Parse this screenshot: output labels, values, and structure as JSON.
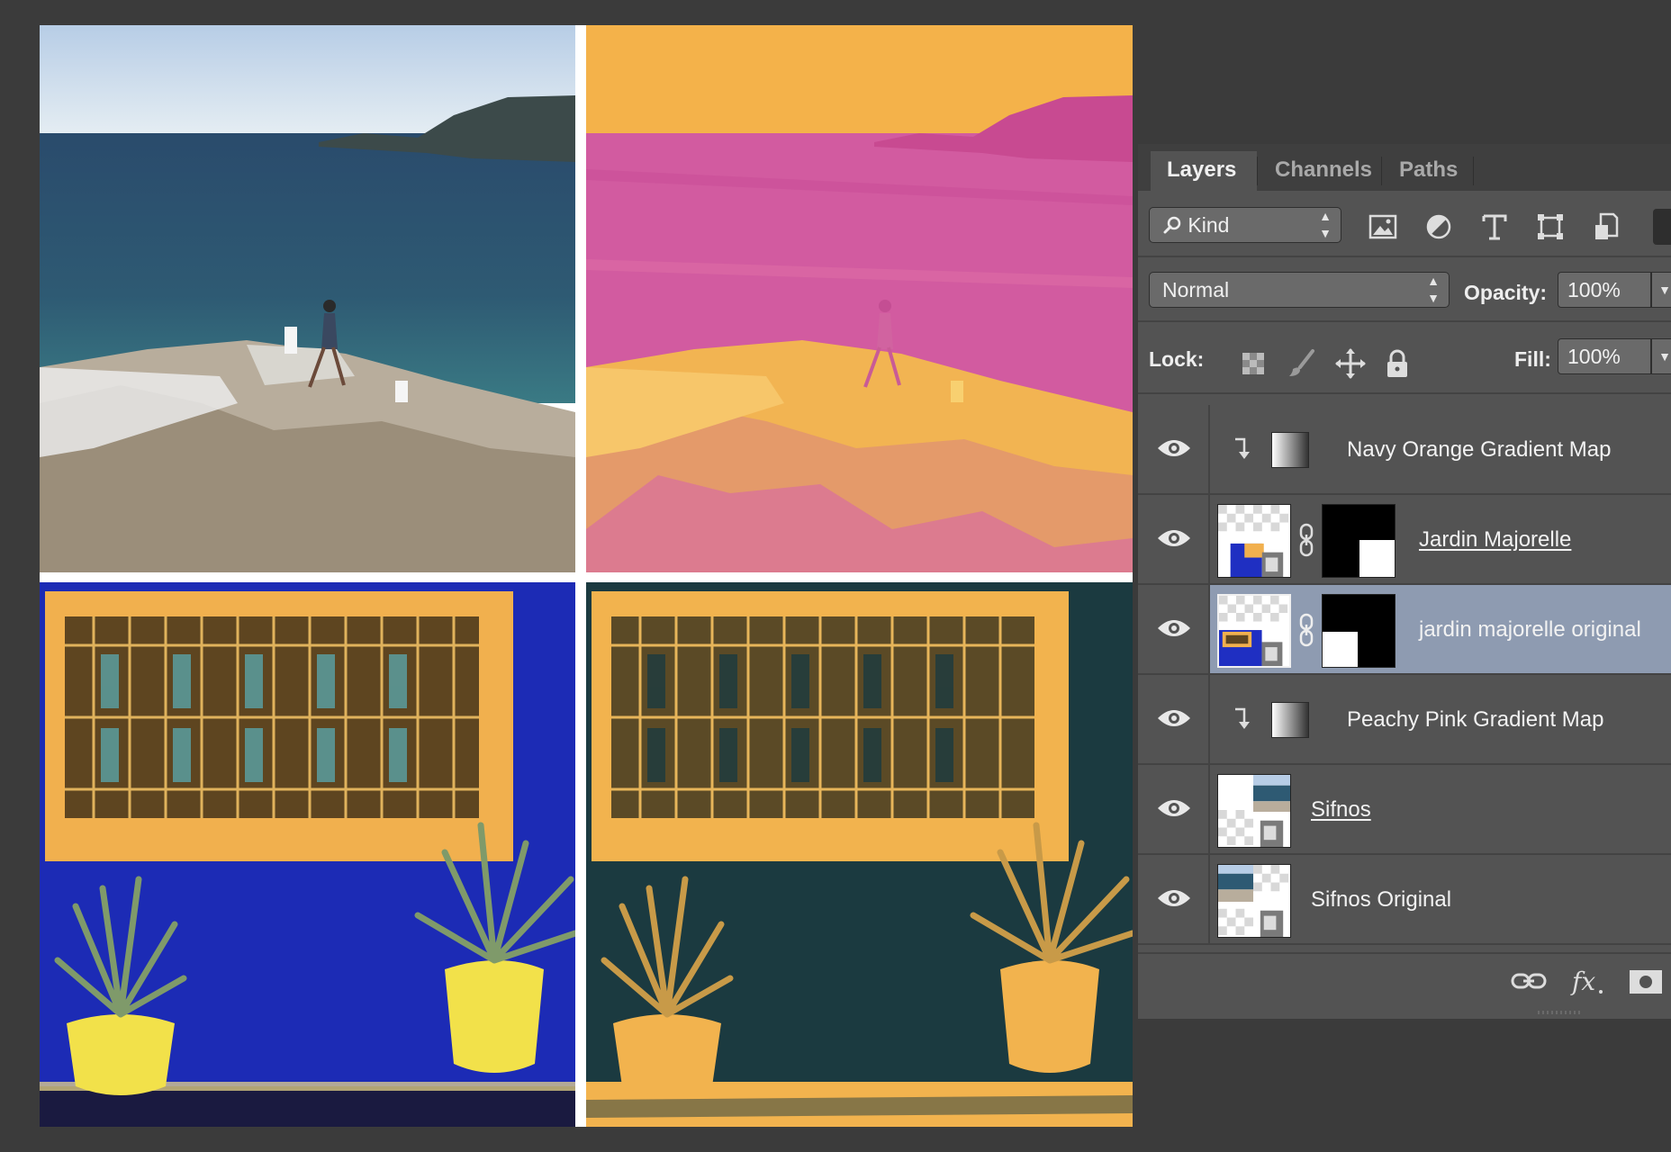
{
  "panel": {
    "tabs": [
      {
        "label": "Layers",
        "active": true
      },
      {
        "label": "Channels",
        "active": false
      },
      {
        "label": "Paths",
        "active": false
      }
    ],
    "filter": {
      "kind_label": "Kind",
      "icons": [
        "image-filter-icon",
        "adjustment-filter-icon",
        "type-filter-icon",
        "shape-filter-icon",
        "smart-object-filter-icon"
      ]
    },
    "blend_mode": "Normal",
    "opacity_label": "Opacity:",
    "opacity_value": "100%",
    "lock_label": "Lock:",
    "fill_label": "Fill:",
    "fill_value": "100%",
    "layers": [
      {
        "name": "Navy Orange Gradient Map",
        "type": "adjustment",
        "clipped": true,
        "visible": true,
        "selected": false
      },
      {
        "name": "Jardin Majorelle",
        "type": "smart",
        "masked": true,
        "visible": true,
        "selected": false
      },
      {
        "name": "jardin majorelle original",
        "type": "smart",
        "masked": true,
        "visible": true,
        "selected": true
      },
      {
        "name": "Peachy Pink Gradient Map",
        "type": "adjustment",
        "clipped": true,
        "visible": true,
        "selected": false
      },
      {
        "name": "Sifnos",
        "type": "smart",
        "visible": true,
        "selected": false
      },
      {
        "name": "Sifnos Original",
        "type": "smart",
        "visible": true,
        "selected": false
      }
    ]
  },
  "colors": {
    "panel_bg": "#535353",
    "selected_row": "#8e9bb1",
    "canvas_bg": "#3b3b3b",
    "majorelle_blue": "#1f2fc2",
    "navy": "#1a3a3f",
    "orange": "#f2b24a",
    "pink": "#d04a9c"
  }
}
